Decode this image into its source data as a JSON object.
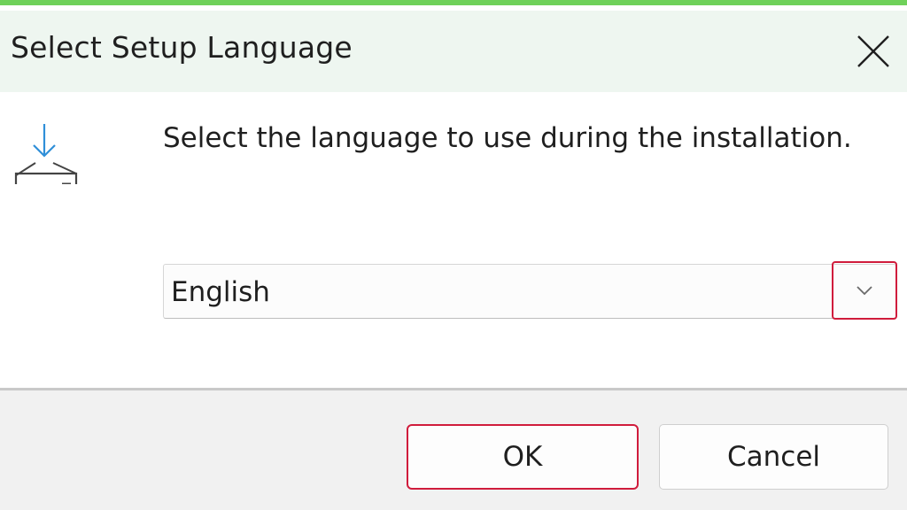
{
  "window": {
    "title": "Select Setup Language",
    "close_icon": "close-icon"
  },
  "main": {
    "icon": "install-download-icon",
    "prompt": "Select the language to use during the installation.",
    "language_select": {
      "selected": "English",
      "dropdown_icon": "chevron-down-icon"
    }
  },
  "footer": {
    "ok_label": "OK",
    "cancel_label": "Cancel"
  },
  "colors": {
    "frame_green": "#6fd15a",
    "highlight_red": "#d01c3c",
    "titlebar_bg": "#eef6f0",
    "footer_bg": "#f1f1f1"
  }
}
